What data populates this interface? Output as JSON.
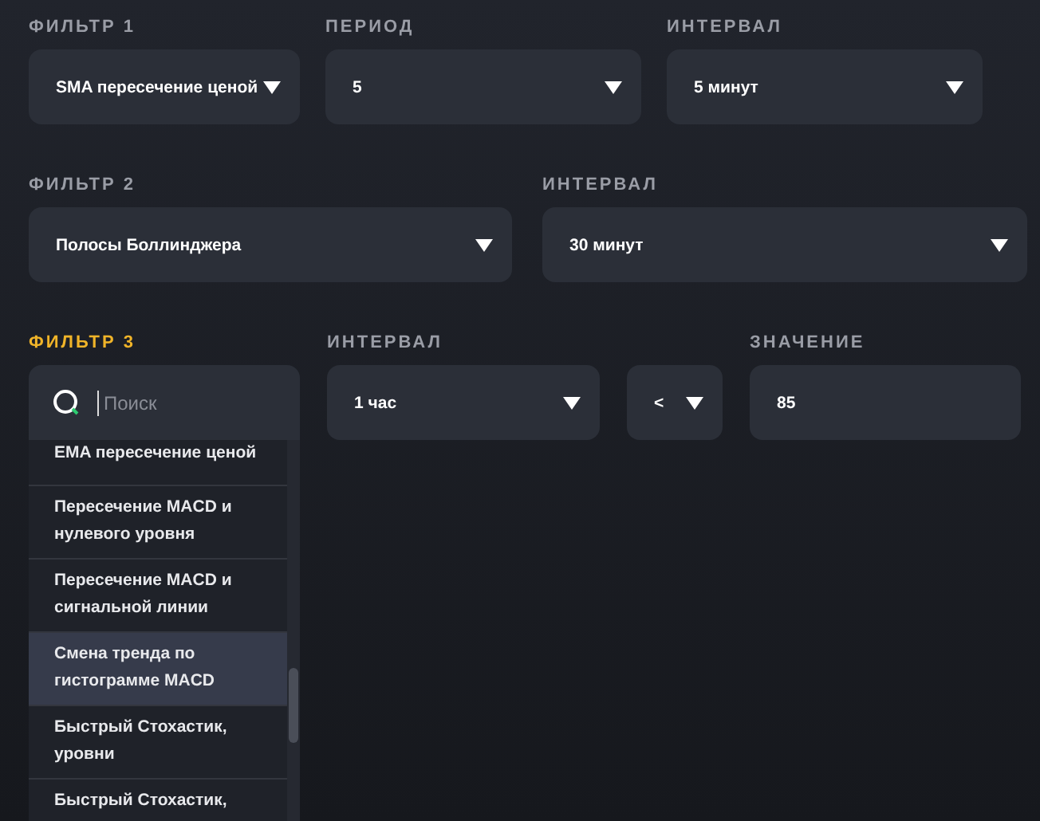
{
  "rows": [
    {
      "fields": [
        {
          "label": "ФИЛЬТР 1",
          "value": "SMA пересечение ценой",
          "active": false,
          "kind": "select"
        },
        {
          "label": "ПЕРИОД",
          "value": "5",
          "active": false,
          "kind": "select"
        },
        {
          "label": "ИНТЕРВАЛ",
          "value": "5 минут",
          "active": false,
          "kind": "select"
        }
      ]
    },
    {
      "fields": [
        {
          "label": "ФИЛЬТР 2",
          "value": "Полосы Боллинджера",
          "active": false,
          "kind": "select"
        },
        {
          "label": "ИНТЕРВАЛ",
          "value": "30 минут",
          "active": false,
          "kind": "select"
        }
      ]
    }
  ],
  "filter3": {
    "label": "ФИЛЬТР 3",
    "active": true,
    "search": {
      "placeholder": "Поиск"
    },
    "options": [
      {
        "label": "EMA пересечение ценой",
        "selected": false
      },
      {
        "label": "Пересечение MACD и нулевого уровня",
        "selected": false
      },
      {
        "label": "Пересечение MACD и сигнальной линии",
        "selected": false
      },
      {
        "label": "Смена тренда по гистограмме MACD",
        "selected": true
      },
      {
        "label": "Быстрый Стохастик, уровни",
        "selected": false
      },
      {
        "label": "Быстрый Стохастик,",
        "selected": false
      }
    ]
  },
  "interval3": {
    "label": "ИНТЕРВАЛ",
    "value": "1 час"
  },
  "operator": {
    "value": "<"
  },
  "threshold": {
    "label": "ЗНАЧЕНИЕ",
    "value": "85"
  }
}
